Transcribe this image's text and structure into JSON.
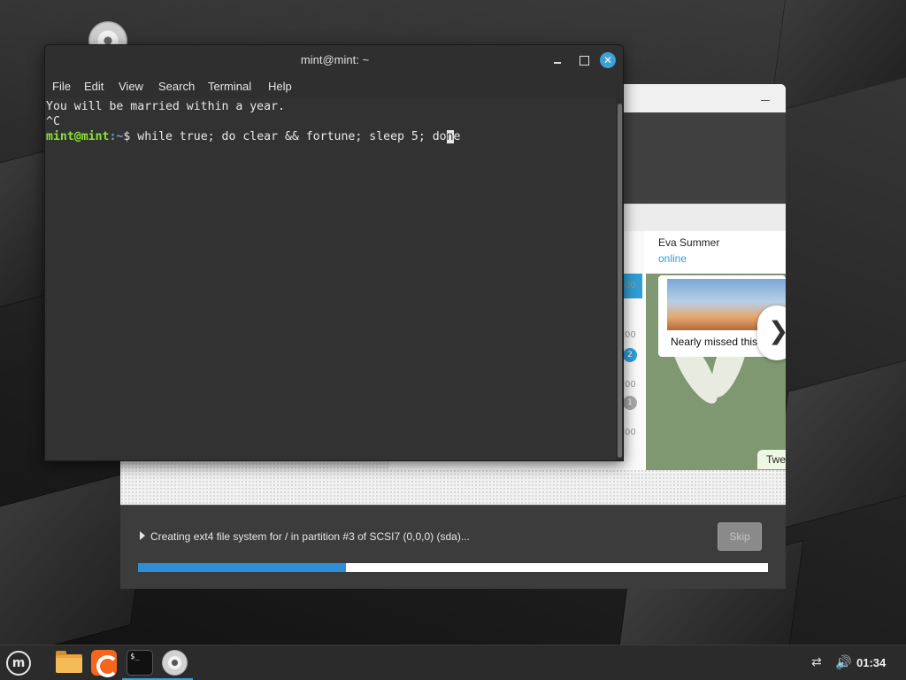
{
  "terminal": {
    "title": "mint@mint: ~",
    "menu": [
      "File",
      "Edit",
      "View",
      "Search",
      "Terminal",
      "Help"
    ],
    "output_line1": "You will be married within a year.",
    "output_line2": "^C",
    "prompt_user": "mint@mint",
    "prompt_path": ":~",
    "prompt_symbol": "$ ",
    "command_before_cursor": "while true; do clear && fortune; sleep 5; do",
    "command_cursor_char": "n",
    "command_after_cursor": "e"
  },
  "installer": {
    "slide": {
      "contact_name": "Eva Summer",
      "contact_status": "online",
      "message_preview": "Nearly missed this s",
      "message_preview2": "Twe",
      "badges": [
        "2",
        "1"
      ],
      "times": [
        "00",
        "00",
        "00",
        "00"
      ],
      "next_arrow": "❯"
    },
    "status_text": "Creating ext4 file system for / in partition #3 of SCSI7 (0,0,0) (sda)...",
    "skip_label": "Skip",
    "progress": 0.33
  },
  "taskbar": {
    "clock": "01:34",
    "launchers": [
      "menu-icon",
      "folder-icon",
      "firefox-icon",
      "terminal-icon",
      "disc-icon"
    ],
    "terminal_glyph": "$_",
    "mint_glyph": "m",
    "network_glyph": "⇄",
    "volume_glyph": "🔊"
  },
  "colors": {
    "accent": "#3ea0d8",
    "prompt_user": "#8ae234",
    "prompt_path": "#729fcf"
  }
}
